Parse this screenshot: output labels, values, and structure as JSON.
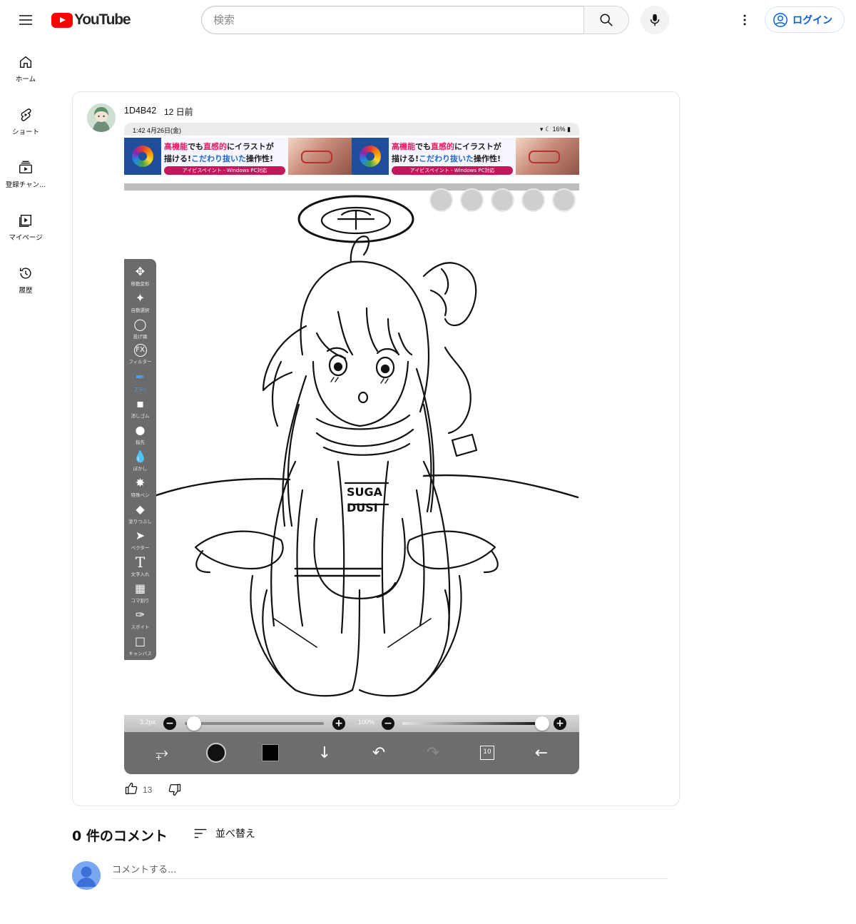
{
  "header": {
    "logo_text": "YouTube",
    "search_placeholder": "検索",
    "login_label": "ログイン"
  },
  "sidebar": {
    "items": [
      {
        "label": "ホーム",
        "icon": "home-icon"
      },
      {
        "label": "ショート",
        "icon": "shorts-icon"
      },
      {
        "label": "登録チャン...",
        "icon": "subscriptions-icon"
      },
      {
        "label": "マイページ",
        "icon": "library-icon"
      },
      {
        "label": "履歴",
        "icon": "history-icon"
      }
    ]
  },
  "post": {
    "author": "1D4B42",
    "time": "12 日前",
    "like_count": "13",
    "image": {
      "status_time": "1:42  4月26日(金)",
      "status_right": "16%",
      "ads": [
        {
          "line1_red": "高機能",
          "line1_a": "でも",
          "line1_red2": "直感的",
          "line1_b": "にイラストが",
          "line2_a": "描ける!",
          "line2_blue": "こだわり抜いた",
          "line2_b": "操作性!",
          "line3": "アイビスペイント - Windows PC対応"
        },
        {
          "line1_red": "高機能",
          "line1_a": "でも",
          "line1_red2": "直感的",
          "line1_b": "にイラストが",
          "line2_a": "描ける!",
          "line2_blue": "こだわり抜いた",
          "line2_b": "操作性!",
          "line3": "アイビスペイント - Windows PC対応"
        }
      ],
      "tools": [
        "移動変形",
        "自動選択",
        "投げ縄",
        "フィルター",
        "ブラシ",
        "消しゴム",
        "指先",
        "ぼかし",
        "特殊ペン",
        "塗りつぶし",
        "ベクター",
        "文字入れ",
        "コマ割り",
        "スポイト",
        "キャンバス"
      ],
      "brush_size": "3.2px",
      "opacity": "100%",
      "brush_size_level": 0.05,
      "opacity_level": 1.0,
      "layer_count": "10"
    }
  },
  "comments": {
    "title": "0 件のコメント",
    "sort_label": "並べ替え",
    "input_placeholder": "コメントする..."
  }
}
